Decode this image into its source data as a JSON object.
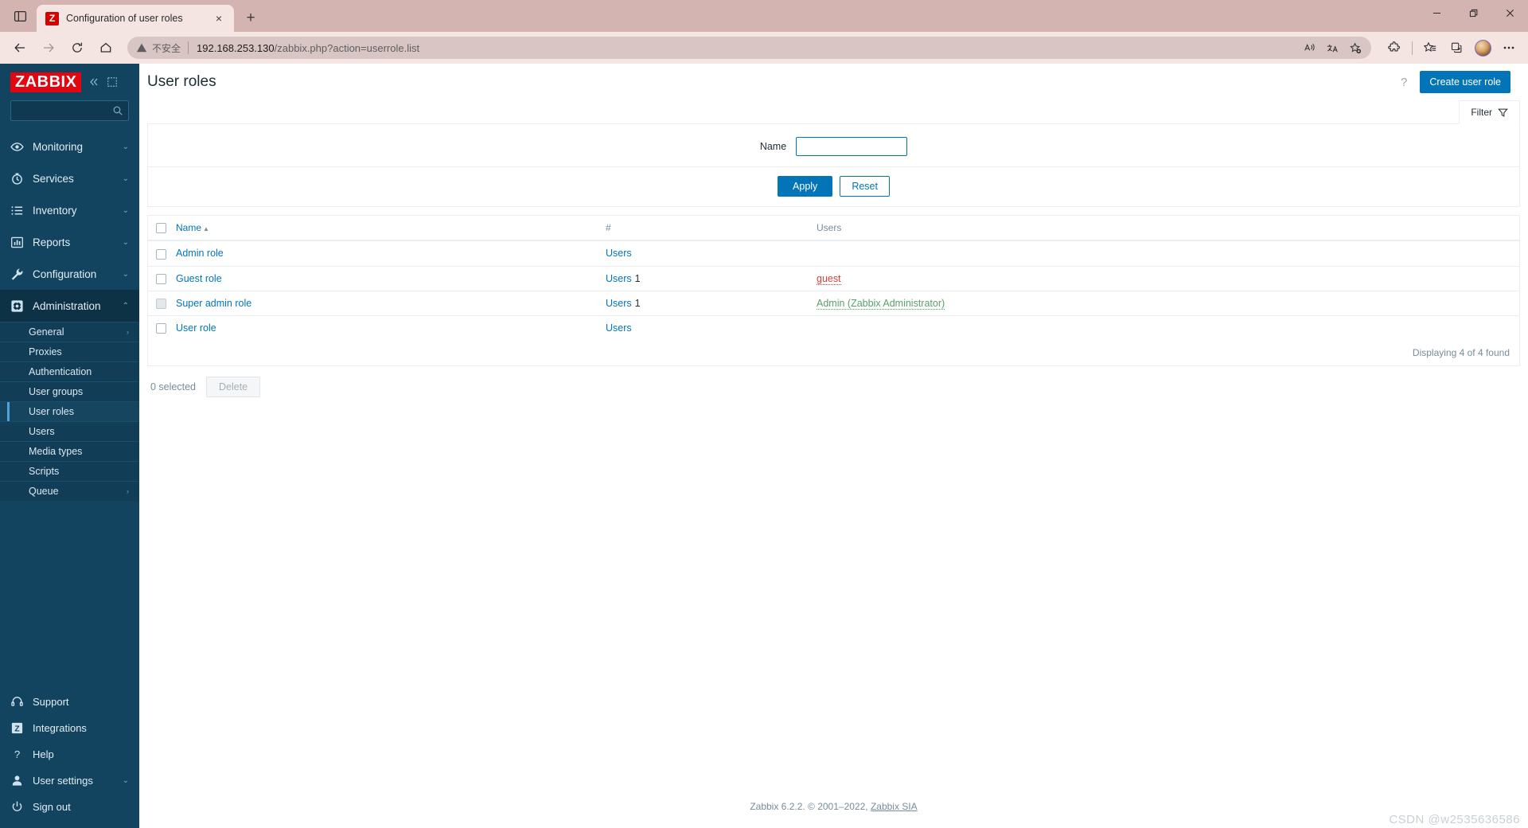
{
  "browser": {
    "tab": {
      "title": "Configuration of user roles",
      "favicon_letter": "Z",
      "close_label": "×"
    },
    "new_tab_label": "+",
    "omnibox": {
      "security_text": "不安全",
      "url_host": "192.168.253.130",
      "url_path": "/zabbix.php?action=userrole.list"
    },
    "icons": {
      "tab_list": "tab-list-icon",
      "back": "back-arrow-icon",
      "forward": "forward-arrow-icon",
      "refresh": "refresh-icon",
      "home": "home-icon",
      "warning": "warning-triangle-icon",
      "read_aloud": "read-aloud-icon",
      "translate": "translate-icon",
      "add_favorite": "add-favorite-icon",
      "extensions": "extensions-puzzle-icon",
      "favorites": "favorites-star-icon",
      "collections": "collections-icon",
      "profile": "profile-avatar-icon",
      "settings": "settings-ellipsis-icon",
      "minimize": "minimize-icon",
      "restore": "restore-icon",
      "close": "close-window-icon"
    }
  },
  "sidebar": {
    "logo": "ZABBIX",
    "search_placeholder": "",
    "search_value": "",
    "nav": [
      {
        "label": "Monitoring",
        "icon": "eye-icon",
        "chevron": "⌄"
      },
      {
        "label": "Services",
        "icon": "clock-icon",
        "chevron": "⌄"
      },
      {
        "label": "Inventory",
        "icon": "list-icon",
        "chevron": "⌄"
      },
      {
        "label": "Reports",
        "icon": "bar-chart-icon",
        "chevron": "⌄"
      },
      {
        "label": "Configuration",
        "icon": "wrench-icon",
        "chevron": "⌄"
      },
      {
        "label": "Administration",
        "icon": "gear-icon",
        "chevron": "⌃"
      }
    ],
    "submenu": [
      {
        "label": "General",
        "chevron": "›",
        "active": false
      },
      {
        "label": "Proxies",
        "chevron": "",
        "active": false
      },
      {
        "label": "Authentication",
        "chevron": "",
        "active": false
      },
      {
        "label": "User groups",
        "chevron": "",
        "active": false
      },
      {
        "label": "User roles",
        "chevron": "",
        "active": true
      },
      {
        "label": "Users",
        "chevron": "",
        "active": false
      },
      {
        "label": "Media types",
        "chevron": "",
        "active": false
      },
      {
        "label": "Scripts",
        "chevron": "",
        "active": false
      },
      {
        "label": "Queue",
        "chevron": "›",
        "active": false
      }
    ],
    "bottom": [
      {
        "label": "Support",
        "icon": "headset-icon",
        "chevron": ""
      },
      {
        "label": "Integrations",
        "icon": "zabbix-z-icon",
        "chevron": ""
      },
      {
        "label": "Help",
        "icon": "question-mark-icon",
        "chevron": ""
      },
      {
        "label": "User settings",
        "icon": "person-icon",
        "chevron": "⌄"
      },
      {
        "label": "Sign out",
        "icon": "power-icon",
        "chevron": ""
      }
    ]
  },
  "page": {
    "title": "User roles",
    "help_icon_label": "?",
    "create_button": "Create user role"
  },
  "filter": {
    "tab_label": "Filter",
    "name_label": "Name",
    "name_value": "",
    "name_placeholder": "",
    "apply_label": "Apply",
    "reset_label": "Reset"
  },
  "table": {
    "headers": {
      "name": "Name",
      "hash": "#",
      "users": "Users"
    },
    "sort_arrow": "▲",
    "rows": [
      {
        "name": "Admin role",
        "users_link": "Users",
        "count": "",
        "assigned": [],
        "checkbox_disabled": false
      },
      {
        "name": "Guest role",
        "users_link": "Users",
        "count": "1",
        "assigned": [
          {
            "text": "guest",
            "status": "disabled"
          }
        ],
        "checkbox_disabled": false
      },
      {
        "name": "Super admin role",
        "users_link": "Users",
        "count": "1",
        "assigned": [
          {
            "text": "Admin (Zabbix Administrator)",
            "status": "enabled"
          }
        ],
        "checkbox_disabled": true
      },
      {
        "name": "User role",
        "users_link": "Users",
        "count": "",
        "assigned": [],
        "checkbox_disabled": false
      }
    ],
    "displaying": "Displaying 4 of 4 found"
  },
  "actions": {
    "selected_text": "0 selected",
    "delete_label": "Delete"
  },
  "footer": {
    "copyright": "Zabbix 6.2.2. © 2001–2022, ",
    "link": "Zabbix SIA"
  },
  "watermark": "CSDN @w2535636586",
  "colors": {
    "zabbix_red": "#e30611",
    "sidebar_blue": "#12435f",
    "accent_blue": "#0275b8",
    "status_disabled_red": "#d43f3a",
    "status_enabled_green": "#59a06a",
    "browser_chrome": "#d3b4b0"
  }
}
